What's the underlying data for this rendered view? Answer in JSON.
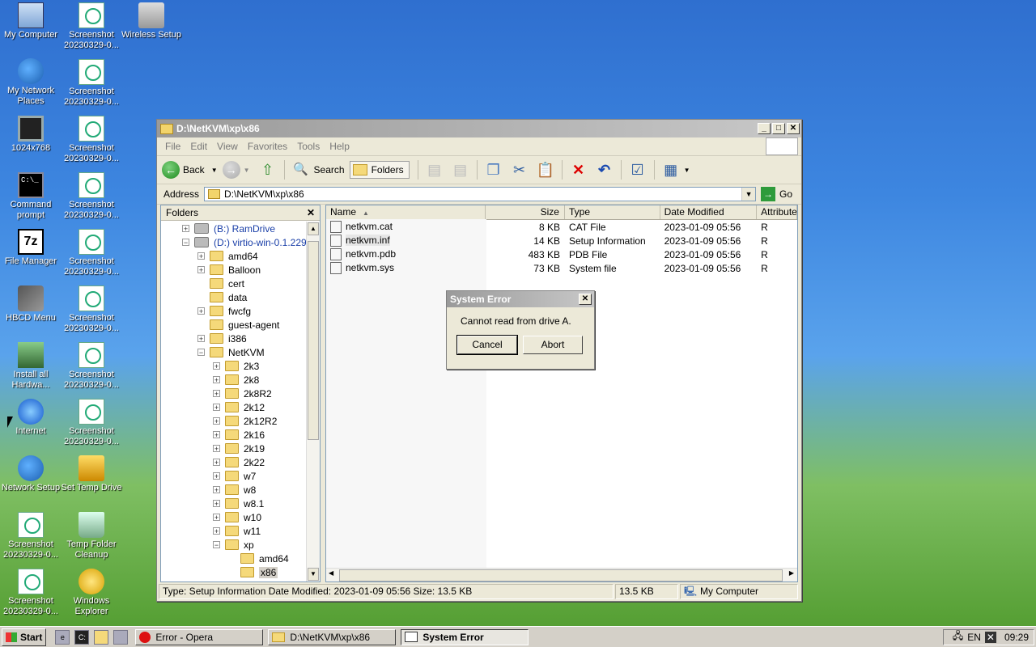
{
  "desktop": {
    "icons": [
      {
        "label": "My Computer"
      },
      {
        "label": "My Network Places"
      },
      {
        "label": "1024x768"
      },
      {
        "label": "Command prompt"
      },
      {
        "label": "File Manager"
      },
      {
        "label": "HBCD Menu"
      },
      {
        "label": "Install all Hardwa..."
      },
      {
        "label": "Internet"
      },
      {
        "label": "Network Setup"
      },
      {
        "label": "Screenshot 20230329-0..."
      },
      {
        "label": "Screenshot 20230329-0..."
      },
      {
        "label": "Screenshot 20230329-0..."
      },
      {
        "label": "Screenshot 20230329-0..."
      },
      {
        "label": "Screenshot 20230329-0..."
      },
      {
        "label": "Screenshot 20230329-0..."
      },
      {
        "label": "Screenshot 20230329-0..."
      },
      {
        "label": "Screenshot 20230329-0..."
      },
      {
        "label": "Set Temp Drive"
      },
      {
        "label": "Temp Folder Cleanup"
      },
      {
        "label": "Windows Explorer"
      },
      {
        "label": "Wireless Setup"
      }
    ]
  },
  "window": {
    "title": "D:\\NetKVM\\xp\\x86",
    "menu": [
      "File",
      "Edit",
      "View",
      "Favorites",
      "Tools",
      "Help"
    ],
    "toolbar": {
      "back": "Back",
      "search": "Search",
      "folders": "Folders"
    },
    "address": {
      "label": "Address",
      "value": "D:\\NetKVM\\xp\\x86",
      "go": "Go"
    },
    "folders_pane": {
      "title": "Folders",
      "close": "✕",
      "tree": [
        {
          "label": "(B:) RamDrive"
        },
        {
          "label": "(D:) virtio-win-0.1.229"
        },
        {
          "label": "amd64"
        },
        {
          "label": "Balloon"
        },
        {
          "label": "cert"
        },
        {
          "label": "data"
        },
        {
          "label": "fwcfg"
        },
        {
          "label": "guest-agent"
        },
        {
          "label": "i386"
        },
        {
          "label": "NetKVM"
        },
        {
          "label": "2k3"
        },
        {
          "label": "2k8"
        },
        {
          "label": "2k8R2"
        },
        {
          "label": "2k12"
        },
        {
          "label": "2k12R2"
        },
        {
          "label": "2k16"
        },
        {
          "label": "2k19"
        },
        {
          "label": "2k22"
        },
        {
          "label": "w7"
        },
        {
          "label": "w8"
        },
        {
          "label": "w8.1"
        },
        {
          "label": "w10"
        },
        {
          "label": "w11"
        },
        {
          "label": "xp"
        },
        {
          "label": "amd64"
        },
        {
          "label": "x86"
        }
      ]
    },
    "file_list": {
      "columns": [
        "Name",
        "Size",
        "Type",
        "Date Modified",
        "Attributes"
      ],
      "rows": [
        {
          "name": "netkvm.cat",
          "size": "8 KB",
          "type": "CAT File",
          "date": "2023-01-09 05:56",
          "attr": "R"
        },
        {
          "name": "netkvm.inf",
          "size": "14 KB",
          "type": "Setup Information",
          "date": "2023-01-09 05:56",
          "attr": "R"
        },
        {
          "name": "netkvm.pdb",
          "size": "483 KB",
          "type": "PDB File",
          "date": "2023-01-09 05:56",
          "attr": "R"
        },
        {
          "name": "netkvm.sys",
          "size": "73 KB",
          "type": "System file",
          "date": "2023-01-09 05:56",
          "attr": "R"
        }
      ]
    },
    "status": {
      "info": "Type: Setup Information Date Modified: 2023-01-09 05:56 Size: 13.5 KB",
      "size": "13.5 KB",
      "zone": "My Computer"
    }
  },
  "dialog": {
    "title": "System Error",
    "close": "✕",
    "message": "Cannot read from drive A.",
    "cancel": "Cancel",
    "abort": "Abort"
  },
  "taskbar": {
    "start": "Start",
    "tasks": [
      {
        "label": "Error - Opera"
      },
      {
        "label": "D:\\NetKVM\\xp\\x86"
      },
      {
        "label": "System Error"
      }
    ],
    "tray": {
      "lang": "EN",
      "time": "09:29"
    }
  },
  "colors": {
    "title_inactive": "#9a9a9a",
    "desktop_sky": "#3d86e0",
    "desktop_grass": "#4f9a2c"
  }
}
